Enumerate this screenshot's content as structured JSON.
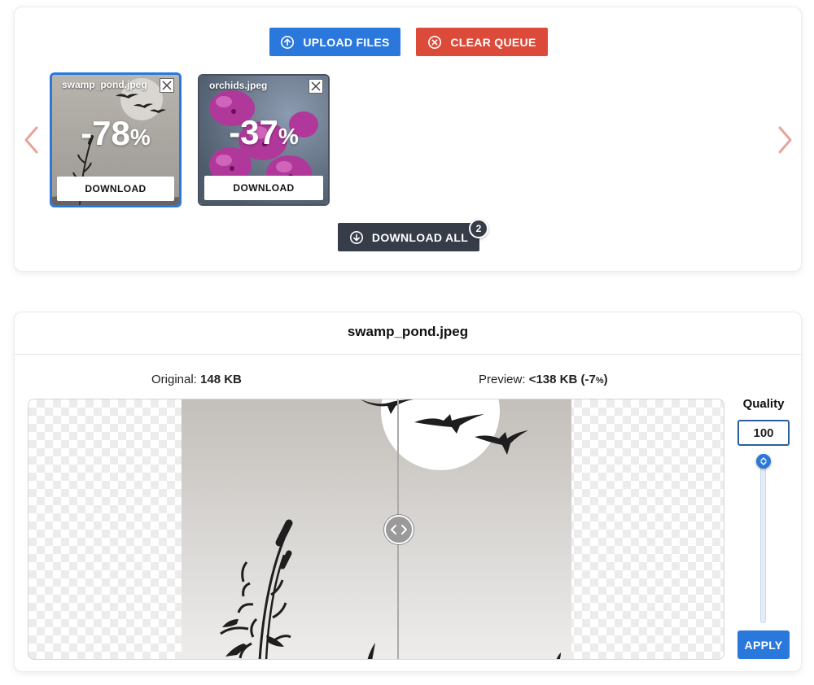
{
  "toolbar": {
    "upload_label": "UPLOAD FILES",
    "clear_label": "CLEAR QUEUE"
  },
  "queue": {
    "items": [
      {
        "name": "swamp_pond.jpeg",
        "percent": "-78",
        "percent_sign": "%",
        "download_label": "DOWNLOAD",
        "selected": true
      },
      {
        "name": "orchids.jpeg",
        "percent": "-37",
        "percent_sign": "%",
        "download_label": "DOWNLOAD",
        "selected": false
      }
    ],
    "download_all_label": "DOWNLOAD ALL",
    "download_all_count": "2"
  },
  "editor": {
    "title": "swamp_pond.jpeg",
    "original_label": "Original:",
    "original_size": "148 KB",
    "preview_label": "Preview:",
    "preview_size": "<138 KB (-7",
    "preview_pct_sign": "%",
    "preview_close": ")",
    "quality_label": "Quality",
    "quality_value": "100",
    "apply_label": "APPLY"
  },
  "colors": {
    "primary": "#2b78dc",
    "danger": "#dc4a3a",
    "dark": "#363d48",
    "arrow": "#e8a39a"
  }
}
